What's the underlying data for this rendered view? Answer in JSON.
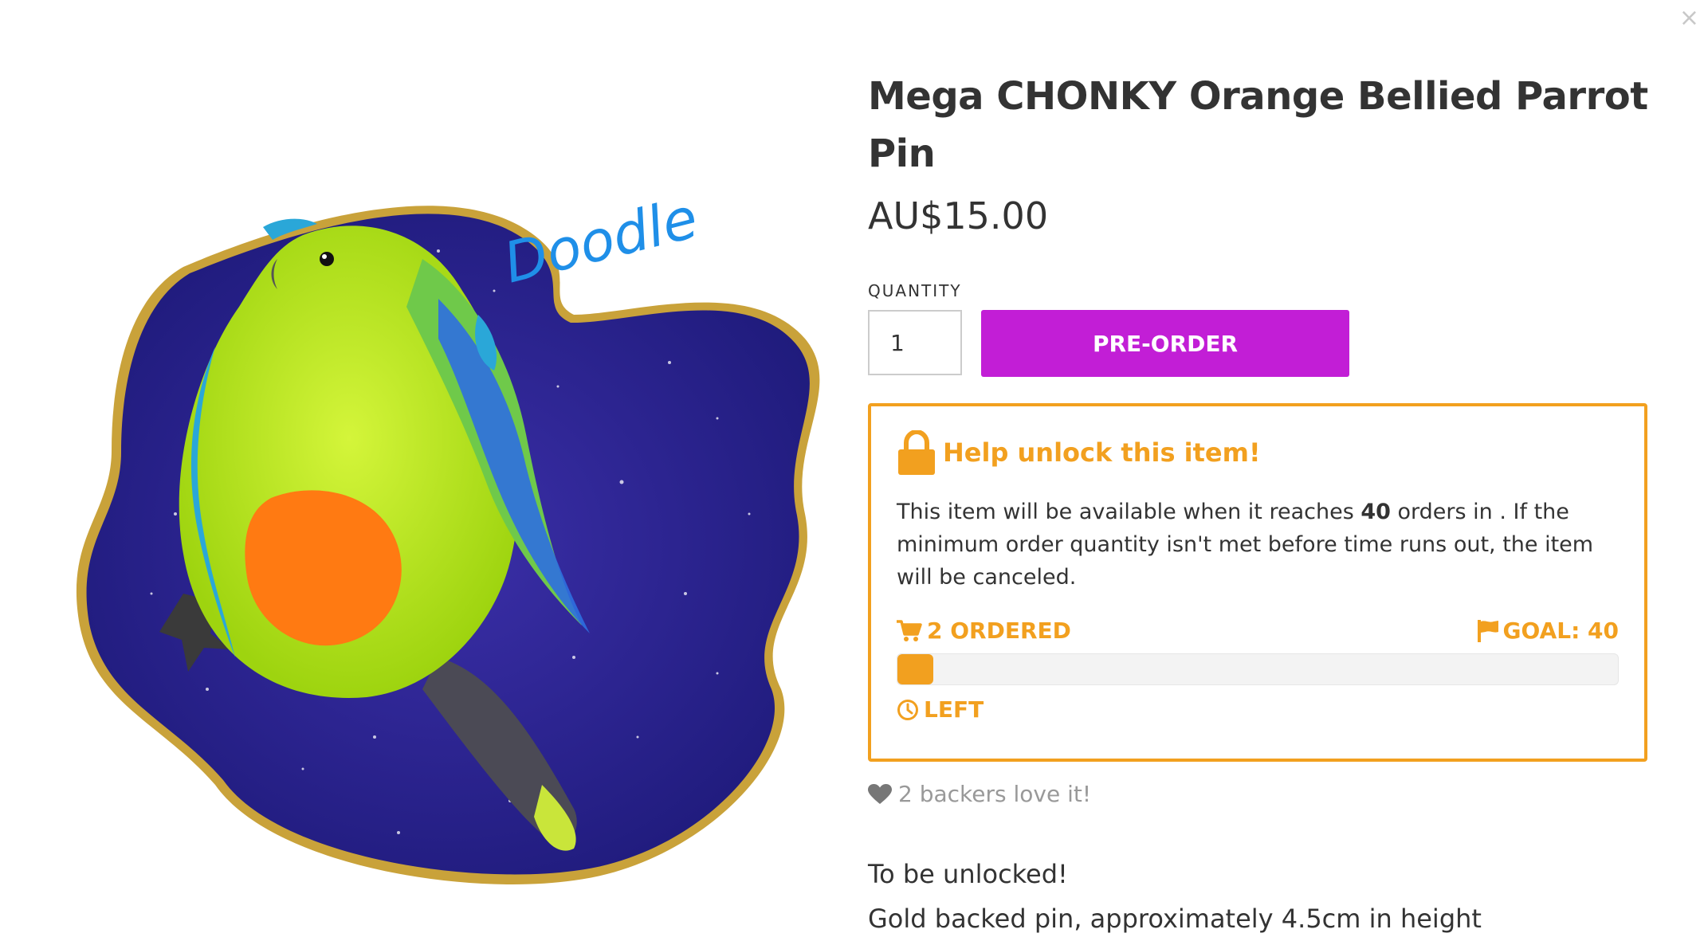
{
  "modal": {
    "close_label": "×"
  },
  "product": {
    "image_text": "Doodle",
    "title": "Mega CHONKY Orange Bellied Parrot Pin",
    "price": "AU$15.00"
  },
  "purchase": {
    "quantity_label": "QUANTITY",
    "quantity_value": "1",
    "preorder_label": "PRE-ORDER"
  },
  "unlock": {
    "title": "Help unlock this item!",
    "text_before": "This item will be available when it reaches ",
    "goal_number": "40",
    "text_after": " orders in . If the minimum order quantity isn't met before time runs out, the item will be canceled.",
    "ordered_label": "2 ORDERED",
    "goal_label": "GOAL: 40",
    "progress_fraction": 0.05,
    "left_label": "LEFT"
  },
  "social": {
    "backers_label": "2 backers love it!"
  },
  "description": {
    "line1": "To be unlocked!",
    "line2": "Gold backed pin, approximately 4.5cm in height"
  },
  "colors": {
    "accent_orange": "#f2a01f",
    "preorder_purple": "#c21ed6",
    "text_dark": "#333333",
    "text_muted": "#999999"
  },
  "icons": [
    "close-icon",
    "lock-icon",
    "cart-icon",
    "flag-icon",
    "clock-icon",
    "heart-icon"
  ]
}
